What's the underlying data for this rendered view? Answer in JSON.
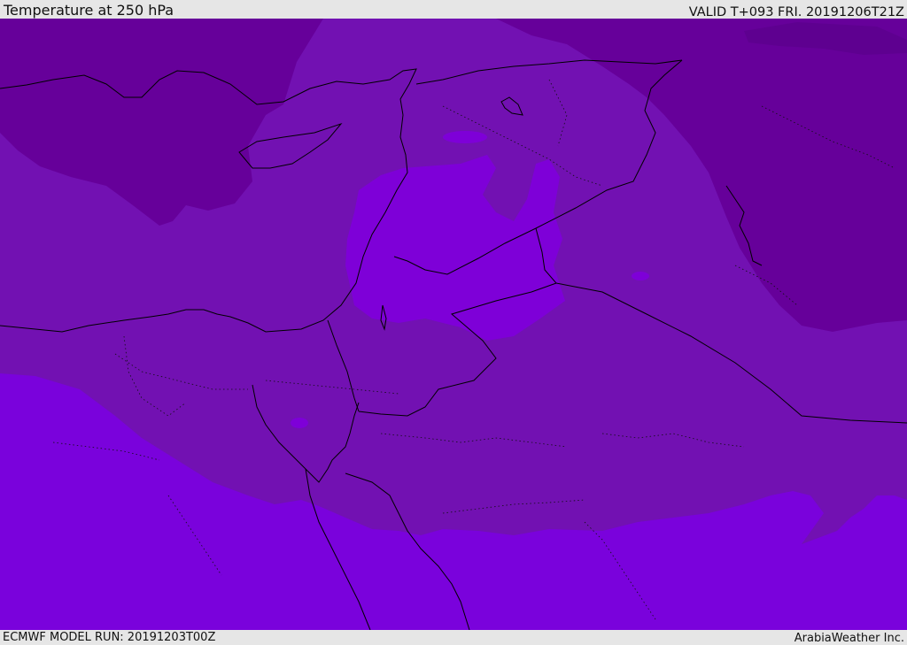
{
  "header": {
    "title": "Temperature at 250 hPa",
    "valid_time": "VALID T+093 FRI. 20191206T21Z"
  },
  "footer": {
    "model_run": "ECMWF MODEL RUN: 20191203T00Z",
    "credit": "ArabiaWeather Inc."
  },
  "map": {
    "colors": {
      "coldest_band": "#66009a",
      "cold_band": "#7211b2",
      "mid_band": "#7e00d8",
      "warm_band": "#7a02dc",
      "border": "#000000"
    }
  }
}
